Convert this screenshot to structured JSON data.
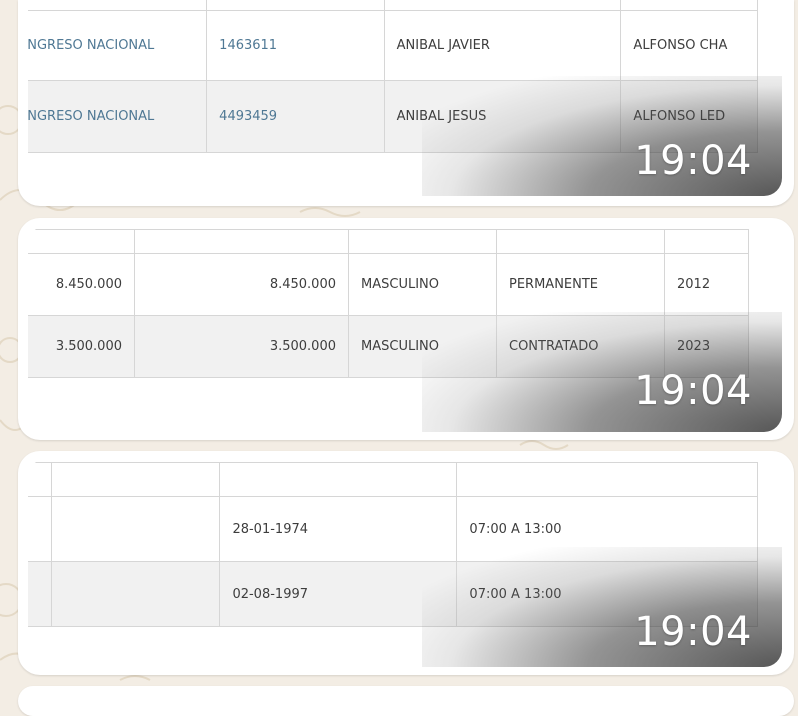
{
  "messages": [
    {
      "time": "19:04",
      "rows": [
        [
          "ONGRESO NACIONAL",
          "1463611",
          "ANIBAL JAVIER",
          "ALFONSO CHA"
        ],
        [
          "ONGRESO NACIONAL",
          "4493459",
          "ANIBAL JESUS",
          "ALFONSO LED"
        ]
      ]
    },
    {
      "time": "19:04",
      "rows": [
        [
          "8.450.000",
          "8.450.000",
          "MASCULINO",
          "PERMANENTE",
          "2012"
        ],
        [
          "3.500.000",
          "3.500.000",
          "MASCULINO",
          "CONTRATADO",
          "2023"
        ]
      ]
    },
    {
      "time": "19:04",
      "rows": [
        [
          "",
          "",
          "28-01-1974",
          "07:00 A 13:00"
        ],
        [
          "",
          "",
          "02-08-1997",
          "07:00 A 13:00"
        ]
      ]
    }
  ],
  "colors": {
    "chat_background": "#f3ede4",
    "bubble": "#ffffff",
    "link_text": "#4f7894",
    "cell_text": "#3d3d3d",
    "alt_row": "#f1f1f1",
    "grid_line": "#d6d6d6"
  }
}
